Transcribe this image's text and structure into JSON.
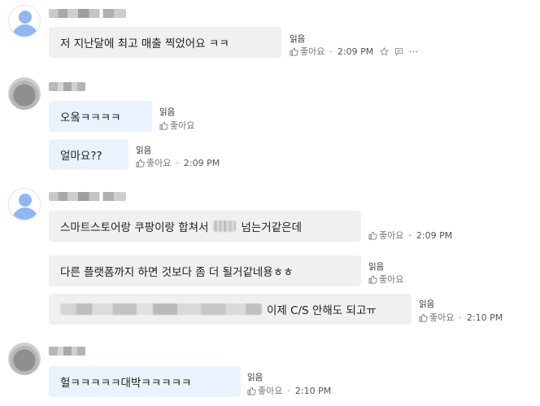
{
  "chat": {
    "read_label": "읽음",
    "like_label": "좋아요",
    "dot": "·",
    "m1": {
      "text": "저 지난달에 최고 매출 찍었어요 ㅋㅋ",
      "time": "2:09 PM"
    },
    "m2": {
      "text": "오옼ㅋㅋㅋㅋ"
    },
    "m3": {
      "text": "얼마요??",
      "time": "2:09 PM"
    },
    "m4": {
      "text_before": "스마트스토어랑 쿠팡이랑 합쳐서",
      "text_after": "넘는거같은데",
      "time": "2:09 PM"
    },
    "m5": {
      "text": "다른 플랫폼까지 하면 것보다 좀 더 될거같네용ㅎㅎ"
    },
    "m6": {
      "text_after": "이제 C/S 안해도 되고ㅠ",
      "time": "2:10 PM"
    },
    "m7": {
      "text": "헐ㅋㅋㅋㅋㅋ대박ㅋㅋㅋㅋㅋ",
      "time": "2:10 PM"
    }
  },
  "icons": {
    "thumb": "thumbs-up-icon",
    "star": "star-icon",
    "comment": "comment-icon",
    "more": "more-icon"
  },
  "colors": {
    "bubble_gray": "#f0f0f0",
    "bubble_blue": "#e9f3fe",
    "avatar_blue": "#8fb6f5"
  }
}
